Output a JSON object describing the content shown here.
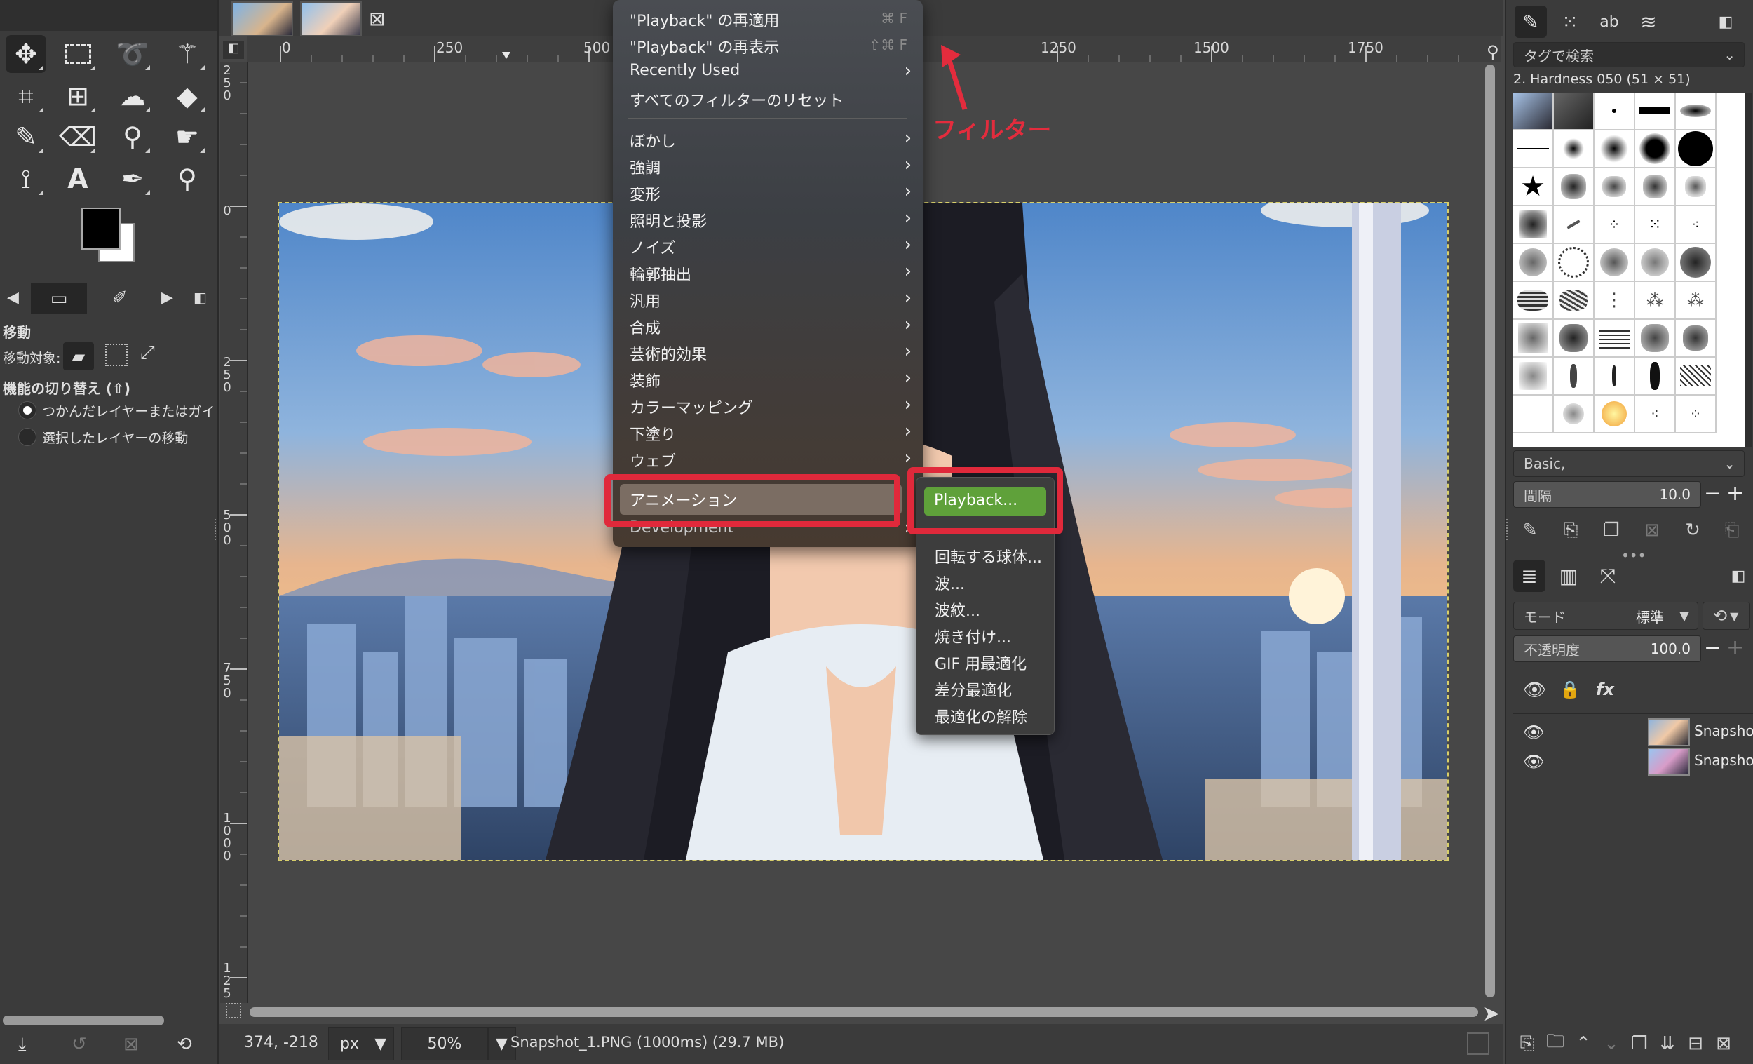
{
  "image_tabs": [
    {
      "name": "image-tab-1"
    },
    {
      "name": "image-tab-2"
    }
  ],
  "toolbox": {
    "tool_name": "移動",
    "move_target_label": "移動対象:",
    "toggle_label": "機能の切り替え (⇧)",
    "radio_options": [
      "つかんだレイヤーまたはガイ",
      "選択したレイヤーの移動"
    ]
  },
  "ruler": {
    "top_ticks": [
      "0",
      "250",
      "500",
      "1250",
      "1500",
      "1750"
    ],
    "left_ticks": [
      [
        "2",
        "5",
        "0"
      ],
      [
        "0"
      ],
      [
        "2",
        "5",
        "0"
      ],
      [
        "5",
        "0",
        "0"
      ],
      [
        "7",
        "5",
        "0"
      ],
      [
        "1",
        "0",
        "0",
        "0"
      ],
      [
        "1",
        "2",
        "5"
      ]
    ]
  },
  "filters_menu": {
    "items_top": [
      {
        "label": "\"Playback\" の再適用",
        "shortcut": "⌘ F"
      },
      {
        "label": "\"Playback\" の再表示",
        "shortcut": "⇧⌘ F"
      },
      {
        "label": "Recently Used",
        "shortcut": ""
      },
      {
        "label": "すべてのフィルターのリセット",
        "shortcut": ""
      }
    ],
    "items": [
      "ぼかし",
      "強調",
      "変形",
      "照明と投影",
      "ノイズ",
      "輪郭抽出",
      "汎用",
      "合成",
      "芸術的効果",
      "装飾",
      "カラーマッピング",
      "下塗り",
      "ウェブ"
    ],
    "animation": "アニメーション",
    "development": "Development"
  },
  "submenu": {
    "items": [
      "Playback...",
      "回転する球体...",
      "波...",
      "波紋...",
      "焼き付け...",
      "GIF 用最適化",
      "差分最適化",
      "最適化の解除"
    ]
  },
  "annotation": {
    "text": "フィルター",
    "color": "#e32c3d"
  },
  "statusbar": {
    "coords": "374, -218",
    "unit": "px",
    "zoom": "50%",
    "file_info": "Snapshot_1.PNG (1000ms) (29.7 MB)"
  },
  "right_dock": {
    "tag_search_placeholder": "タグで検索",
    "brush_name": "2. Hardness 050 (51 × 51)",
    "preset": "Basic,",
    "spacing_label": "間隔",
    "spacing_value": "10.0",
    "mode_label": "モード",
    "mode_value": "標準",
    "opacity_label": "不透明度",
    "opacity_value": "100.0",
    "layers": [
      "Snapshot",
      "Snapshot"
    ]
  },
  "colors": {
    "highlight_red": "#e0293b",
    "playback_green": "#5fa13a",
    "menu_hover": "#7b6d63"
  }
}
